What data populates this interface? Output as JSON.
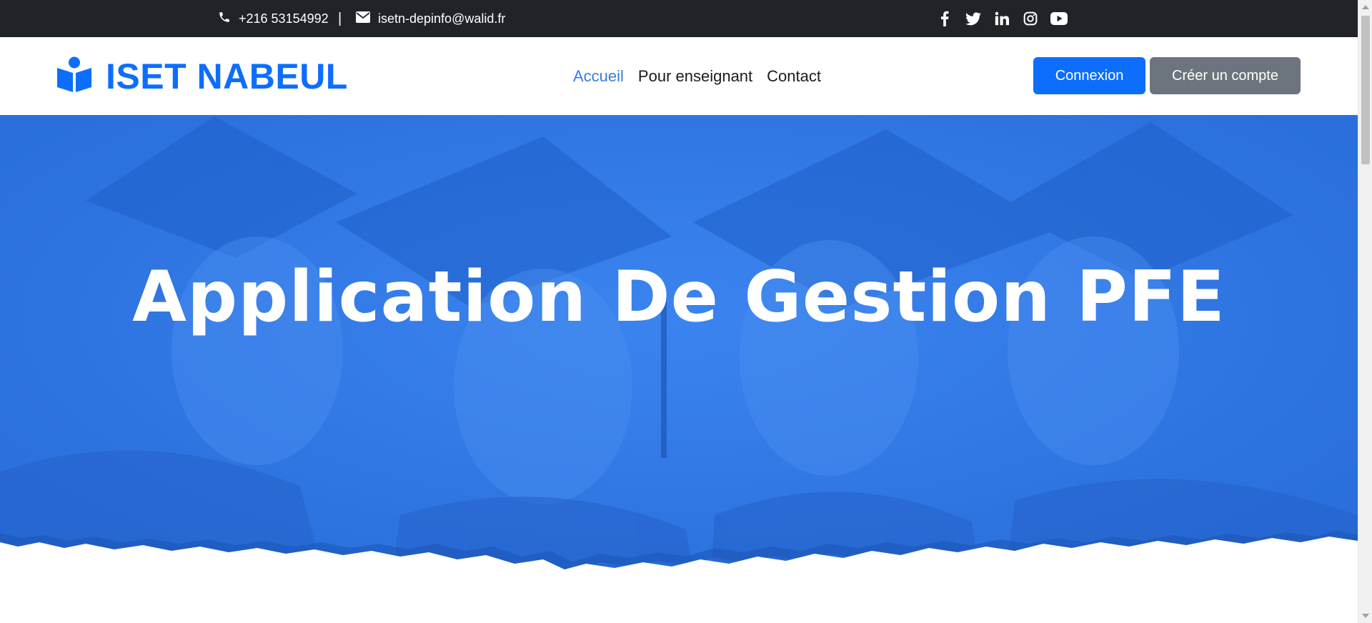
{
  "topbar": {
    "phone": "+216 53154992",
    "separator": "|",
    "email": "isetn-depinfo@walid.fr",
    "social_icons": [
      "facebook-icon",
      "twitter-icon",
      "linkedin-icon",
      "instagram-icon",
      "youtube-icon"
    ]
  },
  "navbar": {
    "brand": "ISET NABEUL",
    "links": [
      "Accueil",
      "Pour enseignant",
      "Contact"
    ],
    "active_link": "Accueil",
    "login_label": "Connexion",
    "register_label": "Créer un compte"
  },
  "hero": {
    "title": "Application De Gestion PFE"
  },
  "colors": {
    "topbar_bg": "#202328",
    "brand": "#0d6efd",
    "active_link": "#3a7be0",
    "login_button": "#0d6efd",
    "register_button": "#6c757d",
    "hero_overlay": "#2f78e6"
  }
}
